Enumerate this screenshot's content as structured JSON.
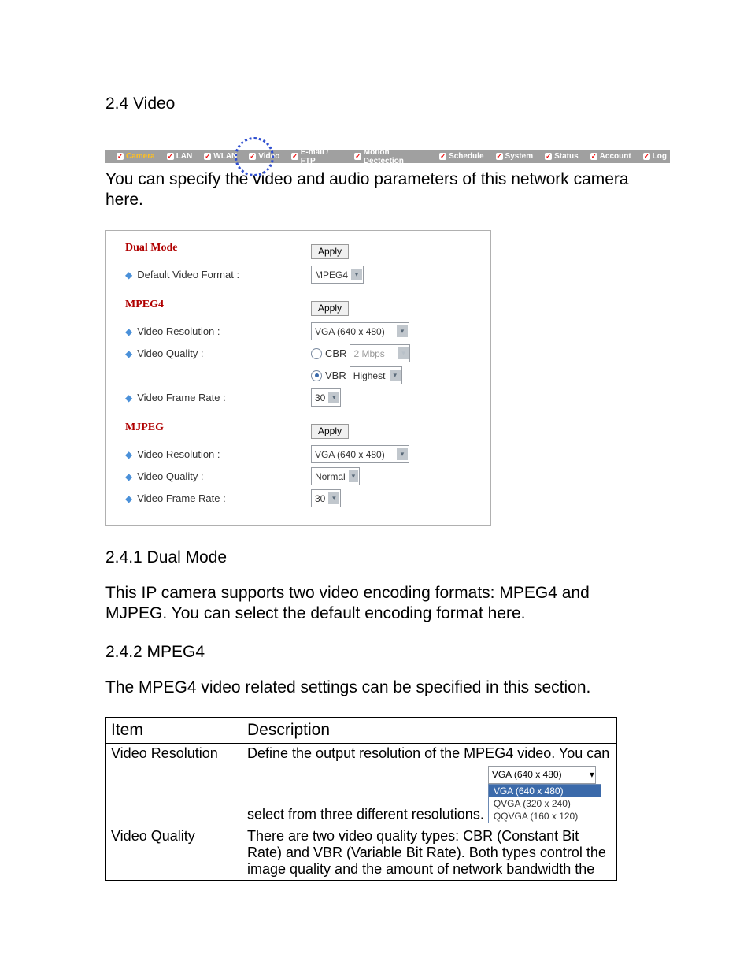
{
  "heading_main": "2.4 Video",
  "tabs": {
    "t0": "Camera",
    "t1": "LAN",
    "t2": "WLAN",
    "t3": "Video",
    "t4": "E-mail / FTP",
    "t5": "Motion Dectection",
    "t6": "Schedule",
    "t7": "System",
    "t8": "Status",
    "t9": "Account",
    "t10": "Log"
  },
  "intro_text": "You can specify the video and audio parameters of this network camera here.",
  "panel": {
    "dual": {
      "title": "Dual Mode",
      "default_format_label": "Default Video Format :",
      "apply": "Apply",
      "format_value": "MPEG4"
    },
    "mpeg4": {
      "title": "MPEG4",
      "apply": "Apply",
      "res_label": "Video Resolution :",
      "res_value": "VGA (640 x 480)",
      "quality_label": "Video Quality :",
      "cbr": "CBR",
      "cbr_value": "2 Mbps",
      "vbr": "VBR",
      "vbr_value": "Highest",
      "frame_label": "Video Frame Rate :",
      "frame_value": "30"
    },
    "mjpeg": {
      "title": "MJPEG",
      "apply": "Apply",
      "res_label": "Video Resolution :",
      "res_value": "VGA (640 x 480)",
      "quality_label": "Video Quality :",
      "quality_value": "Normal",
      "frame_label": "Video Frame Rate :",
      "frame_value": "30"
    }
  },
  "h_241": "2.4.1 Dual Mode",
  "p_241": "This IP camera supports two video encoding formats: MPEG4 and MJPEG. You can select the default encoding format here.",
  "h_242": "2.4.2 MPEG4",
  "p_242": "The MPEG4 video related settings can be specified in this section.",
  "table": {
    "th_item": "Item",
    "th_desc": "Description",
    "r1_item": "Video Resolution",
    "r1_desc": "Define the output resolution of the MPEG4 video. You can select from three different resolutions.",
    "r1_dd_top": "VGA (640 x 480)",
    "r1_opt1": "VGA (640 x 480)",
    "r1_opt2": "QVGA (320 x 240)",
    "r1_opt3": "QQVGA (160 x 120)",
    "r2_item": "Video Quality",
    "r2_desc": "There are two video quality types: CBR (Constant Bit Rate) and VBR (Variable Bit Rate). Both types control the image quality and the amount of network bandwidth the"
  }
}
